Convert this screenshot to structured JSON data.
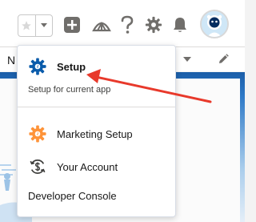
{
  "header": {
    "icons": [
      "star-icon",
      "chevron-down-icon",
      "plus-icon",
      "trailhead-icon",
      "help-icon",
      "gear-icon",
      "bell-icon",
      "avatar"
    ]
  },
  "subbar": {
    "partial_label": "N"
  },
  "menu": {
    "setup": {
      "label": "Setup",
      "sublabel": "Setup for current app"
    },
    "items": [
      {
        "label": "Marketing Setup"
      },
      {
        "label": "Your Account"
      },
      {
        "label": "Developer Console"
      }
    ]
  },
  "colors": {
    "gear_blue": "#0b5cab",
    "gear_orange": "#fe9339",
    "annotation_arrow": "#e8392b"
  }
}
